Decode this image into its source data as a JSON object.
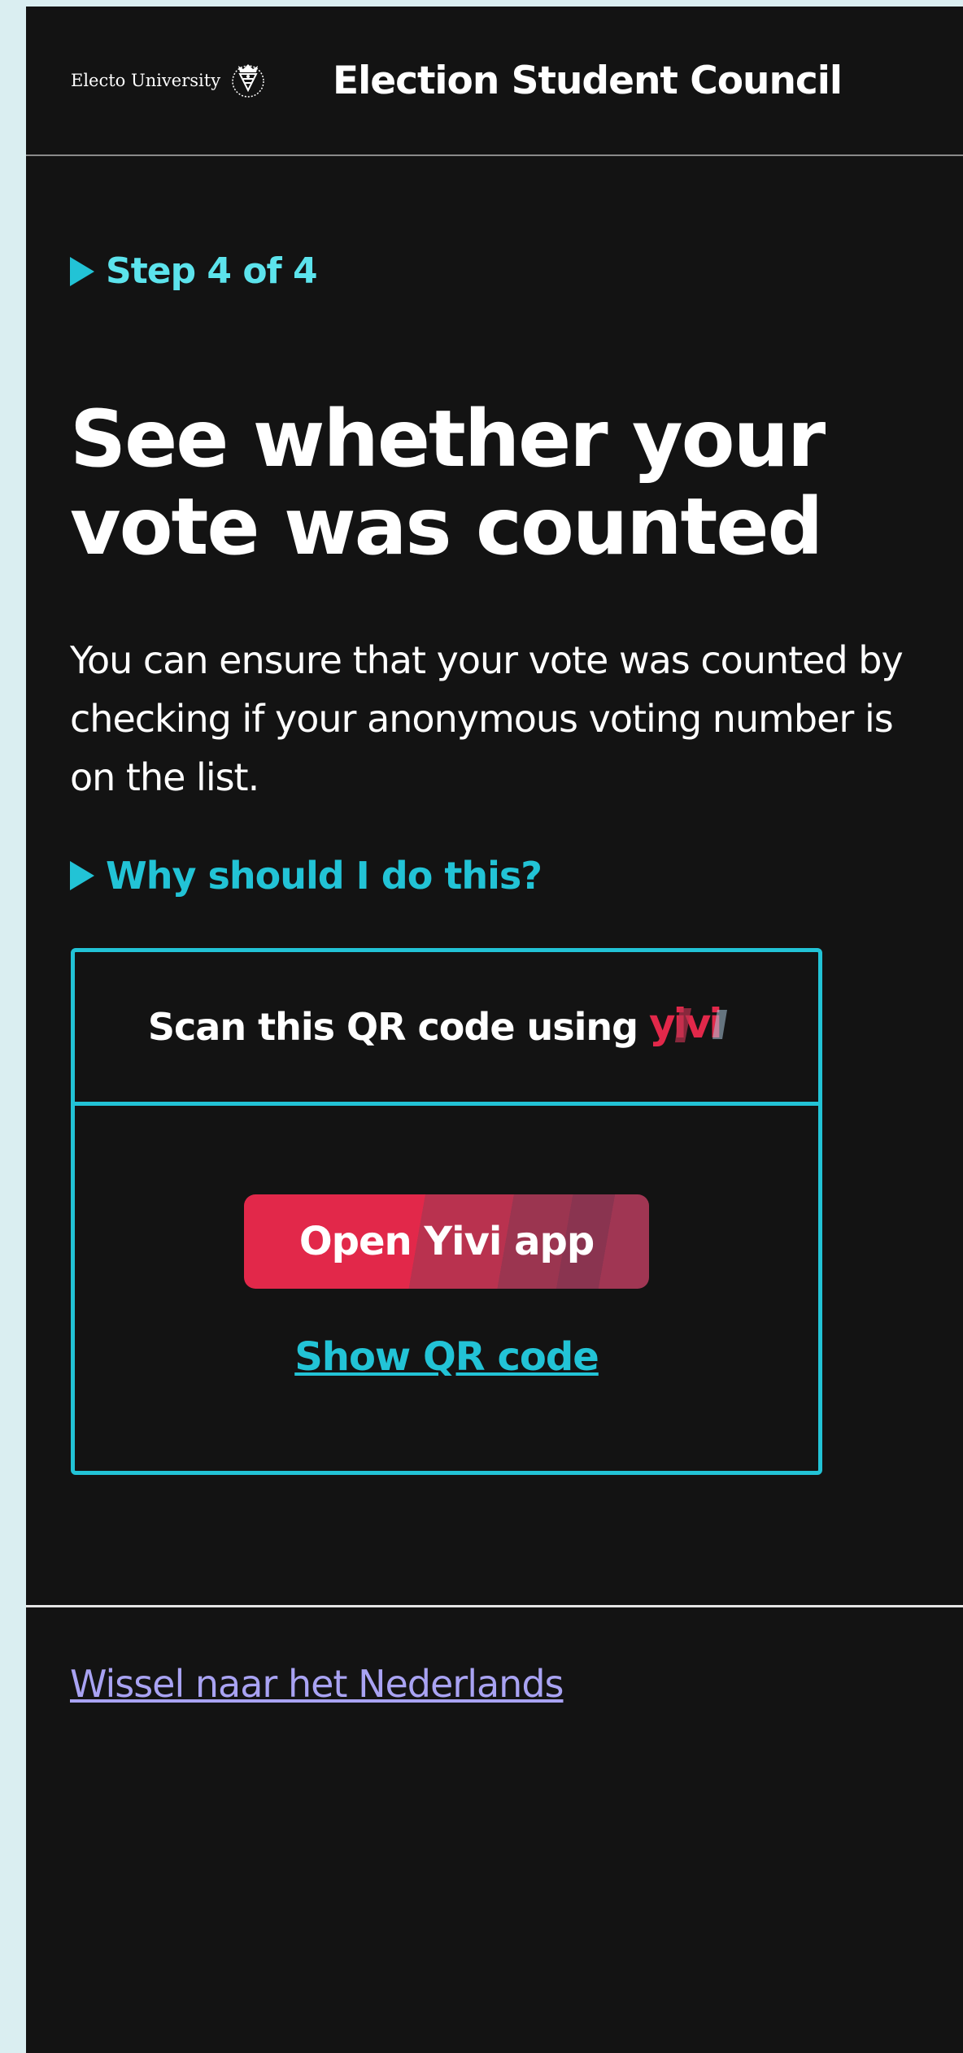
{
  "header": {
    "brand_name": "Electo University",
    "title": "Election Student Council"
  },
  "step": {
    "label": "Step 4 of 4"
  },
  "main": {
    "title_line1": "See whether your",
    "title_line2": "vote was counted",
    "intro": "You can ensure that your vote was counted by checking if your anonymous voting number is on the list.",
    "why_label": "Why should I do this?"
  },
  "qr": {
    "prompt": "Scan this QR code using",
    "logo_text": "yivi",
    "open_button": "Open Yivi app",
    "show_qr": "Show QR code"
  },
  "footer": {
    "language_link": "Wissel naar het Nederlands"
  },
  "colors": {
    "background": "#131313",
    "accent_cyan": "#22c3d6",
    "step_cyan": "#5ce3ec",
    "yivi_red": "#e2284a",
    "link_purple": "#a9a3f3"
  },
  "icons": {
    "university_seal": "university-seal-icon",
    "disclosure": "triangle-right-icon"
  }
}
